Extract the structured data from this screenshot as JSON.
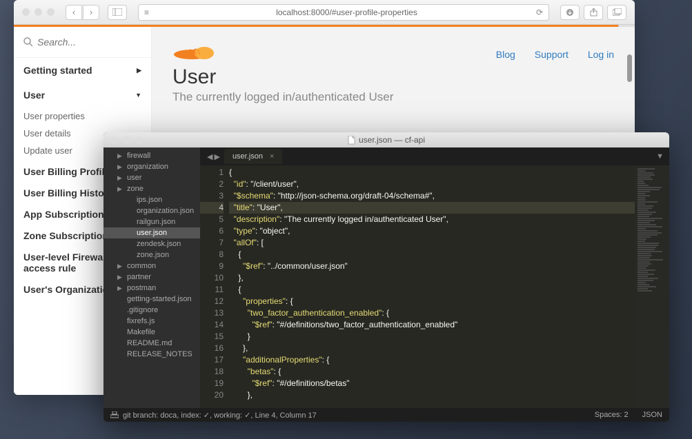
{
  "browser": {
    "url": "localhost:8000/#user-profile-properties",
    "search_placeholder": "Search..."
  },
  "nav": {
    "getting_started": "Getting started",
    "user": "User",
    "user_items": [
      "User properties",
      "User details",
      "Update user"
    ],
    "sections": [
      "User Billing Profile",
      "User Billing History",
      "App Subscription",
      "Zone Subscription",
      "User-level Firewall access rule",
      "User's Organizations"
    ]
  },
  "header": {
    "links": {
      "blog": "Blog",
      "support": "Support",
      "login": "Log in"
    },
    "title": "User",
    "subtitle": "The currently logged in/authenticated User"
  },
  "editor": {
    "window_title": "user.json — cf-api",
    "tab_name": "user.json",
    "tree": {
      "folders_l1": [
        "firewall",
        "organization",
        "user",
        "zone"
      ],
      "files_l2": [
        "ips.json",
        "organization.json",
        "railgun.json",
        "user.json",
        "zendesk.json",
        "zone.json"
      ],
      "selected_l2": "user.json",
      "folders_l1b": [
        "common",
        "partner",
        "postman"
      ],
      "files_l1": [
        "getting-started.json",
        ".gitignore",
        "fixrefs.js",
        "Makefile",
        "README.md",
        "RELEASE_NOTES"
      ]
    },
    "code_lines": [
      "{",
      "  \"id\": \"/client/user\",",
      "  \"$schema\": \"http://json-schema.org/draft-04/schema#\",",
      "  \"title\": \"User\",",
      "  \"description\": \"The currently logged in/authenticated User\",",
      "  \"type\": \"object\",",
      "  \"allOf\": [",
      "    {",
      "      \"$ref\": \"../common/user.json\"",
      "    },",
      "    {",
      "      \"properties\": {",
      "        \"two_factor_authentication_enabled\": {",
      "          \"$ref\": \"#/definitions/two_factor_authentication_enabled\"",
      "        }",
      "      },",
      "      \"additionalProperties\": {",
      "        \"betas\": {",
      "          \"$ref\": \"#/definitions/betas\"",
      "        },"
    ],
    "current_line": 4,
    "status": {
      "left": "git branch: doca, index: ✓, working: ✓, Line 4, Column 17",
      "spaces": "Spaces: 2",
      "lang": "JSON"
    }
  }
}
